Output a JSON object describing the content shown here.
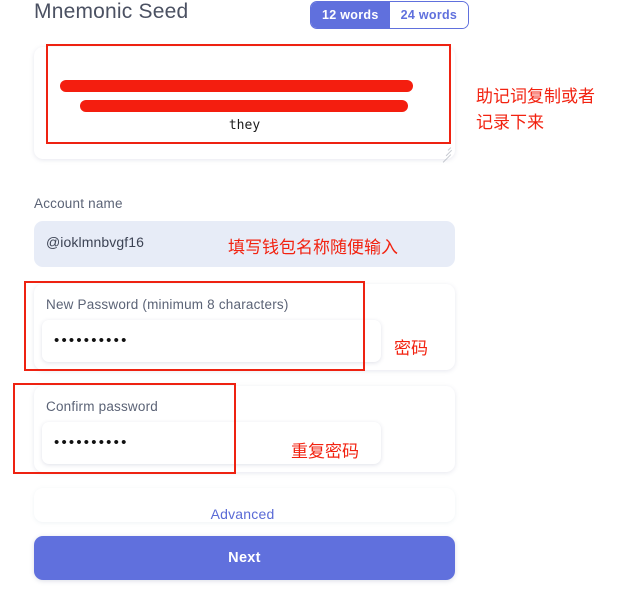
{
  "header": {
    "title": "Mnemonic Seed",
    "word_toggle": {
      "options": [
        "12 words",
        "24 words"
      ],
      "selected": "12 words"
    }
  },
  "mnemonic": {
    "visible_text": "they",
    "redacted_line_1": "",
    "redacted_line_2": "",
    "note": "助记词复制或者\n记录下来"
  },
  "account": {
    "label": "Account name",
    "value": "@ioklmnbvgf16",
    "placeholder": "Account name",
    "note": "填写钱包名称随便输入"
  },
  "new_password": {
    "label": "New Password (minimum 8 characters)",
    "value": "••••••••••",
    "note": "密码"
  },
  "confirm_password": {
    "label": "Confirm password",
    "value": "••••••••••",
    "note": "重复密码"
  },
  "footer": {
    "advanced_label": "Advanced",
    "next_label": "Next"
  },
  "colors": {
    "accent": "#6070dd",
    "annotation_red": "#f22210",
    "label_gray": "#5b6376",
    "account_field_bg": "#e7ecf7"
  }
}
